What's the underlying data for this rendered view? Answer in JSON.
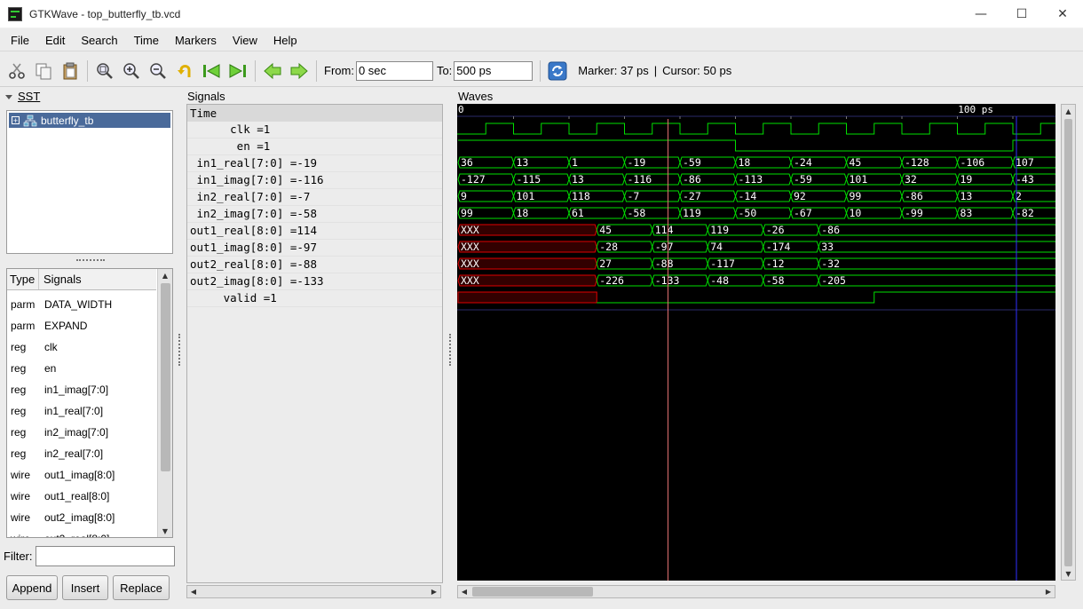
{
  "window": {
    "title": "GTKWave - top_butterfly_tb.vcd",
    "minimize": "—",
    "maximize": "☐",
    "close": "✕"
  },
  "menu": [
    "File",
    "Edit",
    "Search",
    "Time",
    "Markers",
    "View",
    "Help"
  ],
  "toolbar": {
    "from_label": "From:",
    "from_value": "0 sec",
    "to_label": "To:",
    "to_value": "500 ps",
    "marker_text": "Marker: 37 ps",
    "divider": "|",
    "cursor_text": "Cursor: 50 ps",
    "icons": [
      "cut-icon",
      "copy-icon",
      "paste-icon",
      "zoom-fit-icon",
      "zoom-in-icon",
      "zoom-out-icon",
      "undo-icon",
      "zoom-start-icon",
      "zoom-end-icon",
      "prev-icon",
      "next-icon",
      "reload-icon"
    ]
  },
  "sst": {
    "title": "SST",
    "tree_item": "butterfly_tb",
    "header_type": "Type",
    "header_signals": "Signals",
    "signals": [
      {
        "type": "parm",
        "name": "DATA_WIDTH"
      },
      {
        "type": "parm",
        "name": "EXPAND"
      },
      {
        "type": "reg",
        "name": "clk"
      },
      {
        "type": "reg",
        "name": "en"
      },
      {
        "type": "reg",
        "name": "in1_imag[7:0]"
      },
      {
        "type": "reg",
        "name": "in1_real[7:0]"
      },
      {
        "type": "reg",
        "name": "in2_imag[7:0]"
      },
      {
        "type": "reg",
        "name": "in2_real[7:0]"
      },
      {
        "type": "wire",
        "name": "out1_imag[8:0]"
      },
      {
        "type": "wire",
        "name": "out1_real[8:0]"
      },
      {
        "type": "wire",
        "name": "out2_imag[8:0]"
      },
      {
        "type": "wire",
        "name": "out2_real[8:0]"
      }
    ],
    "filter_label": "Filter:",
    "filter_value": "",
    "append": "Append",
    "insert": "Insert",
    "replace": "Replace"
  },
  "signals_panel": {
    "title": "Signals",
    "time_label": "Time",
    "rows": [
      "      clk =1",
      "       en =1",
      " in1_real[7:0] =-19",
      " in1_imag[7:0] =-116",
      " in2_real[7:0] =-7",
      " in2_imag[7:0] =-58",
      "out1_real[8:0] =114",
      "out1_imag[8:0] =-97",
      "out2_real[8:0] =-88",
      "out2_imag[8:0] =-133",
      "     valid =1"
    ]
  },
  "waves": {
    "title": "Waves",
    "ruler_start": "0",
    "ruler_label": "100 ps",
    "marker_ps": 37,
    "cursor_ps": 50,
    "colors": {
      "wave": "#00e000",
      "undefined": "#e00000",
      "cursor": "#e07070",
      "marker": "#3030ff",
      "grid": "#2a2a6a"
    },
    "clk_toggles": [
      5,
      10,
      15,
      20,
      25,
      30,
      35,
      40,
      45,
      50,
      55,
      60,
      65,
      70,
      75,
      80,
      85,
      90,
      95,
      100,
      105
    ],
    "en_high": [
      [
        0,
        50
      ],
      [
        100,
        108
      ]
    ],
    "buses": [
      {
        "name": "in1_real",
        "segments": [
          [
            "36",
            0,
            10
          ],
          [
            "13",
            10,
            20
          ],
          [
            "1",
            20,
            30
          ],
          [
            "-19",
            30,
            40
          ],
          [
            "-59",
            40,
            50
          ],
          [
            "18",
            50,
            60
          ],
          [
            "-24",
            60,
            70
          ],
          [
            "45",
            70,
            80
          ],
          [
            "-128",
            80,
            90
          ],
          [
            "-106",
            90,
            100
          ],
          [
            "107",
            100,
            108
          ]
        ]
      },
      {
        "name": "in1_imag",
        "segments": [
          [
            "-127",
            0,
            10
          ],
          [
            "-115",
            10,
            20
          ],
          [
            "13",
            20,
            30
          ],
          [
            "-116",
            30,
            40
          ],
          [
            "-86",
            40,
            50
          ],
          [
            "-113",
            50,
            60
          ],
          [
            "-59",
            60,
            70
          ],
          [
            "101",
            70,
            80
          ],
          [
            "32",
            80,
            90
          ],
          [
            "19",
            90,
            100
          ],
          [
            "-43",
            100,
            108
          ]
        ]
      },
      {
        "name": "in2_real",
        "segments": [
          [
            "9",
            0,
            10
          ],
          [
            "101",
            10,
            20
          ],
          [
            "118",
            20,
            30
          ],
          [
            "-7",
            30,
            40
          ],
          [
            "-27",
            40,
            50
          ],
          [
            "-14",
            50,
            60
          ],
          [
            "92",
            60,
            70
          ],
          [
            "99",
            70,
            80
          ],
          [
            "-86",
            80,
            90
          ],
          [
            "13",
            90,
            100
          ],
          [
            "2",
            100,
            108
          ]
        ]
      },
      {
        "name": "in2_imag",
        "segments": [
          [
            "99",
            0,
            10
          ],
          [
            "18",
            10,
            20
          ],
          [
            "61",
            20,
            30
          ],
          [
            "-58",
            30,
            40
          ],
          [
            "119",
            40,
            50
          ],
          [
            "-50",
            50,
            60
          ],
          [
            "-67",
            60,
            70
          ],
          [
            "10",
            70,
            80
          ],
          [
            "-99",
            80,
            90
          ],
          [
            "83",
            90,
            100
          ],
          [
            "-82",
            100,
            108
          ]
        ]
      },
      {
        "name": "out1_real",
        "segments": [
          [
            "XXX",
            0,
            25,
            "x"
          ],
          [
            "45",
            25,
            35
          ],
          [
            "114",
            35,
            45
          ],
          [
            "119",
            45,
            55
          ],
          [
            "-26",
            55,
            65
          ],
          [
            "-86",
            65,
            108
          ]
        ]
      },
      {
        "name": "out1_imag",
        "segments": [
          [
            "XXX",
            0,
            25,
            "x"
          ],
          [
            "-28",
            25,
            35
          ],
          [
            "-97",
            35,
            45
          ],
          [
            "74",
            45,
            55
          ],
          [
            "-174",
            55,
            65
          ],
          [
            "33",
            65,
            108
          ]
        ]
      },
      {
        "name": "out2_real",
        "segments": [
          [
            "XXX",
            0,
            25,
            "x"
          ],
          [
            "27",
            25,
            35
          ],
          [
            "-88",
            35,
            45
          ],
          [
            "-117",
            45,
            55
          ],
          [
            "-12",
            55,
            65
          ],
          [
            "-32",
            65,
            108
          ]
        ]
      },
      {
        "name": "out2_imag",
        "segments": [
          [
            "XXX",
            0,
            25,
            "x"
          ],
          [
            "-226",
            25,
            35
          ],
          [
            "-133",
            35,
            45
          ],
          [
            "-48",
            45,
            55
          ],
          [
            "-58",
            55,
            65
          ],
          [
            "-205",
            65,
            108
          ]
        ]
      }
    ],
    "valid": {
      "undefined_until": 25,
      "low_until": 75
    }
  }
}
